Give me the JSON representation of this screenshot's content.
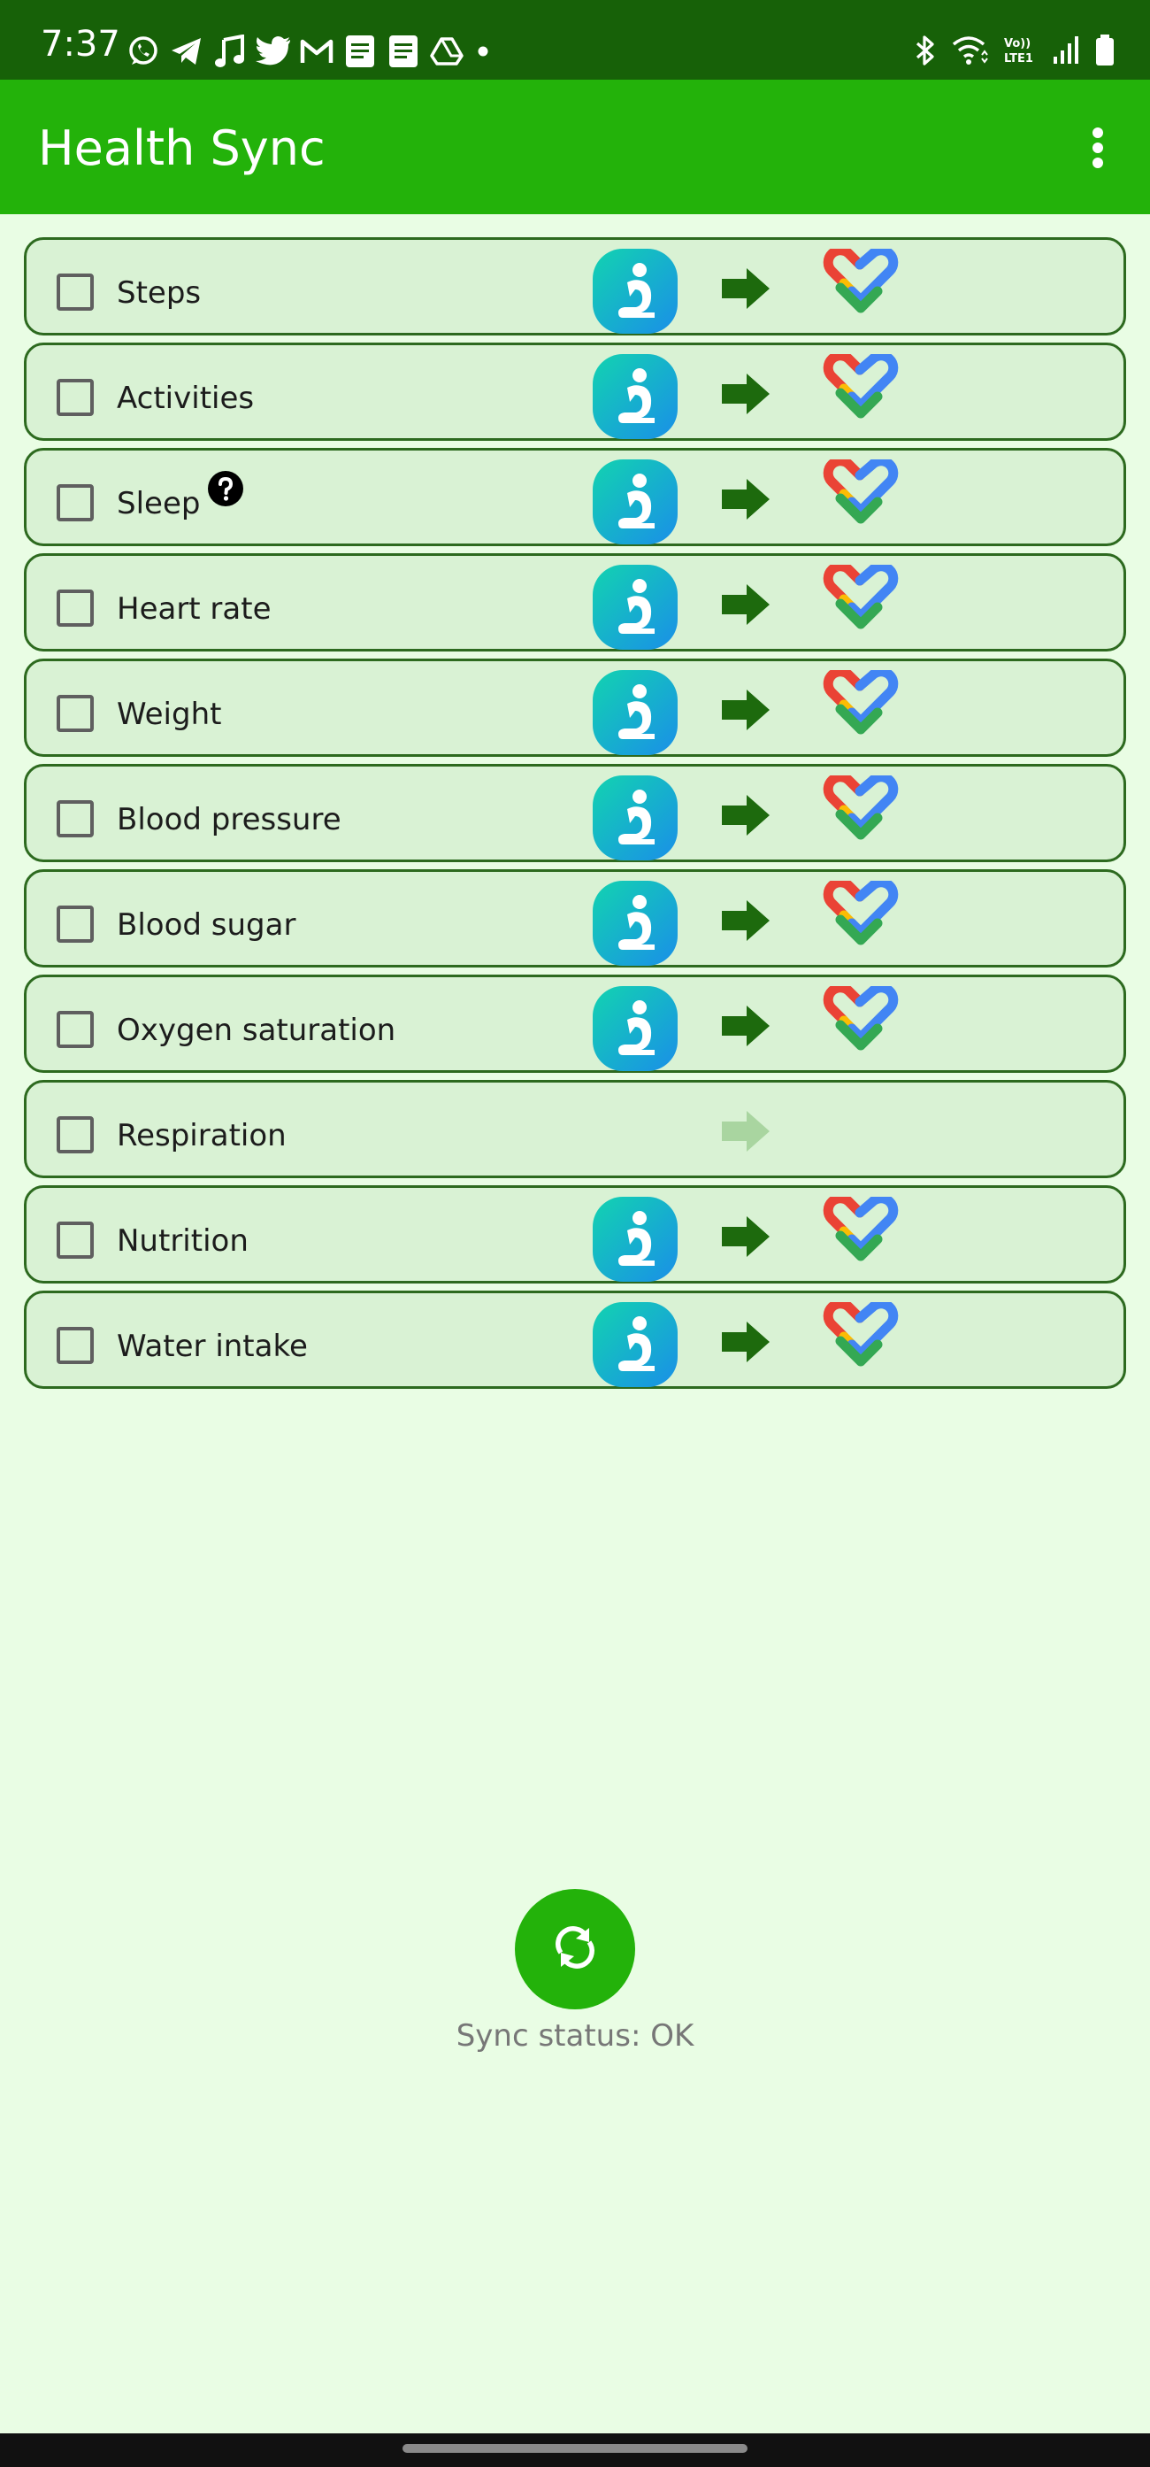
{
  "status_bar": {
    "time": "7:37",
    "left_icons": [
      "whatsapp-icon",
      "telegram-icon",
      "music-note-icon",
      "twitter-icon",
      "gmail-icon",
      "docs-icon",
      "docs-icon",
      "drive-icon",
      "dot-icon"
    ],
    "right_icons": [
      "bluetooth-icon",
      "wifi-icon",
      "volte-icon",
      "signal-icon",
      "battery-icon"
    ],
    "volte_text": "Vo)) LTE1"
  },
  "app_bar": {
    "title": "Health Sync",
    "menu_icon": "more-vert-icon"
  },
  "colors": {
    "status_bar": "#176108",
    "app_bar": "#23b20a",
    "background": "#e9fde4",
    "row_background": "#d9f2d4",
    "row_border": "#2d6a1f",
    "arrow": "#1d6a0d",
    "arrow_disabled": "#a9d5a0",
    "sync_button": "#23b20a"
  },
  "rows": [
    {
      "label": "Steps",
      "checked": false,
      "source_icon": "samsung-health-icon",
      "arrow_icon": "arrow-right-icon",
      "destination_icon": "google-fit-icon"
    },
    {
      "label": "Activities",
      "checked": false,
      "source_icon": "samsung-health-icon",
      "arrow_icon": "arrow-right-icon",
      "destination_icon": "google-fit-icon"
    },
    {
      "label": "Sleep",
      "checked": false,
      "help_icon": "help-circle-icon",
      "source_icon": "samsung-health-icon",
      "arrow_icon": "arrow-right-icon",
      "destination_icon": "google-fit-icon"
    },
    {
      "label": "Heart rate",
      "checked": false,
      "source_icon": "samsung-health-icon",
      "arrow_icon": "arrow-right-icon",
      "destination_icon": "google-fit-icon"
    },
    {
      "label": "Weight",
      "checked": false,
      "source_icon": "samsung-health-icon",
      "arrow_icon": "arrow-right-icon",
      "destination_icon": "google-fit-icon"
    },
    {
      "label": "Blood pressure",
      "checked": false,
      "source_icon": "samsung-health-icon",
      "arrow_icon": "arrow-right-icon",
      "destination_icon": "google-fit-icon"
    },
    {
      "label": "Blood sugar",
      "checked": false,
      "source_icon": "samsung-health-icon",
      "arrow_icon": "arrow-right-icon",
      "destination_icon": "google-fit-icon"
    },
    {
      "label": "Oxygen saturation",
      "checked": false,
      "source_icon": "samsung-health-icon",
      "arrow_icon": "arrow-right-icon",
      "destination_icon": "google-fit-icon"
    },
    {
      "label": "Respiration",
      "checked": false,
      "arrow_icon": "arrow-right-icon",
      "arrow_disabled": true
    },
    {
      "label": "Nutrition",
      "checked": false,
      "source_icon": "samsung-health-icon",
      "arrow_icon": "arrow-right-icon",
      "destination_icon": "google-fit-icon"
    },
    {
      "label": "Water intake",
      "checked": false,
      "source_icon": "samsung-health-icon",
      "arrow_icon": "arrow-right-icon",
      "destination_icon": "google-fit-icon"
    }
  ],
  "sync": {
    "button_icon": "sync-icon",
    "status_text": "Sync status: OK"
  }
}
